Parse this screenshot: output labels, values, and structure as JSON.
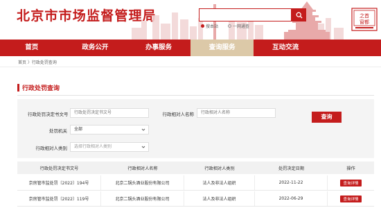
{
  "site": {
    "title": "北京市市场监督管理局",
    "logo_alt": "首都之窗"
  },
  "search": {
    "placeholder": "",
    "options": [
      {
        "label": "搜本站",
        "selected": true
      },
      {
        "label": "一网通查",
        "selected": false
      }
    ]
  },
  "nav": {
    "items": [
      {
        "label": "首页",
        "active": false
      },
      {
        "label": "政务公开",
        "active": false
      },
      {
        "label": "办事服务",
        "active": false
      },
      {
        "label": "查询服务",
        "active": true
      },
      {
        "label": "互动交流",
        "active": false
      },
      {
        "label": "",
        "active": false
      }
    ]
  },
  "breadcrumb": "首页 〉行政处罚查询",
  "section_title": "行政处罚查询",
  "form": {
    "doc_no_label": "行政处罚决定书文号",
    "doc_no_placeholder": "行政处罚决定书文号",
    "party_name_label": "行政相对人名称",
    "party_name_placeholder": "行政相对人名称",
    "authority_label": "处罚机关",
    "authority_value": "全部",
    "party_type_label": "行政相对人类别",
    "party_type_value": "选择行政相对人类别",
    "query_label": "查询"
  },
  "table": {
    "headers": [
      "行政处罚决定书文号",
      "行政相对人名称",
      "行政相对人类别",
      "处罚决定日期",
      "操作"
    ],
    "rows": [
      {
        "doc_no": "京房管市监处罚〔2022〕194号",
        "party": "北京二锅头酒业股份有限公司",
        "type": "法人及非法人组织",
        "date": "2022-11-22",
        "action": "查询详情"
      },
      {
        "doc_no": "京房管市监处罚〔2022〕119号",
        "party": "北京二锅头酒业股份有限公司",
        "type": "法人及非法人组织",
        "date": "2022-06-29",
        "action": "查询详情"
      }
    ]
  },
  "colors": {
    "brand_red": "#c41c1c",
    "active_tab": "#dcc9a8"
  }
}
